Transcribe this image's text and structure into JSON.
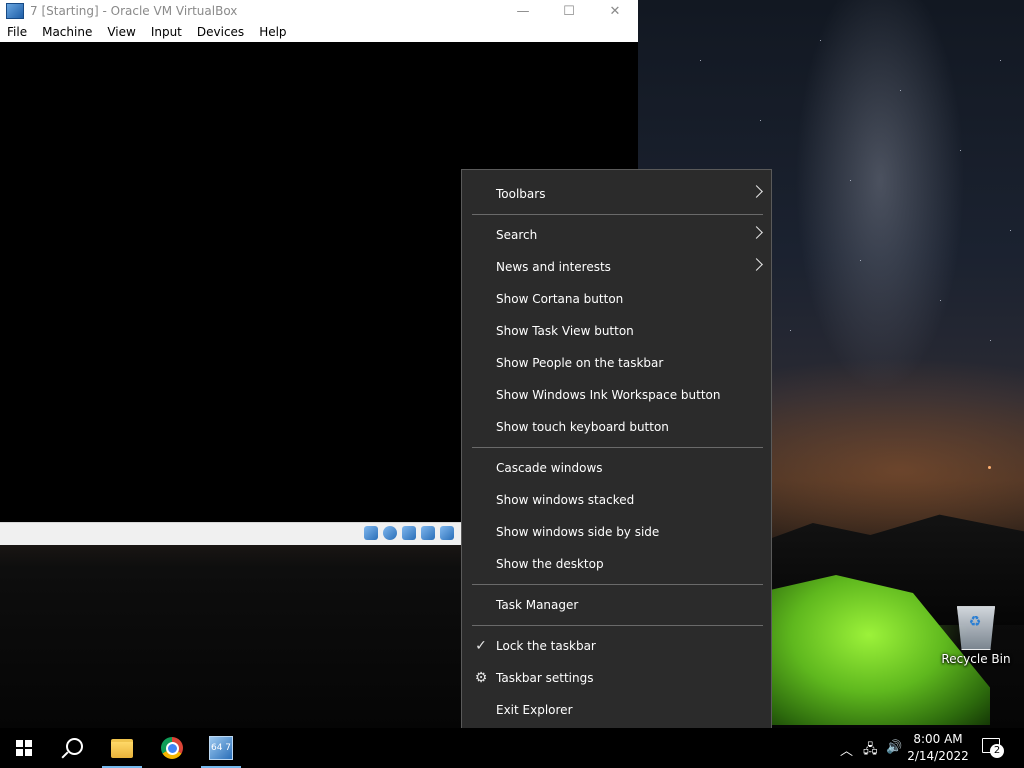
{
  "vbox": {
    "title": "7 [Starting] - Oracle VM VirtualBox",
    "menu": [
      "File",
      "Machine",
      "View",
      "Input",
      "Devices",
      "Help"
    ],
    "window_buttons": {
      "minimize": "—",
      "maximize": "☐",
      "close": "✕"
    }
  },
  "context_menu": {
    "items": [
      {
        "label": "Toolbars",
        "submenu": true
      },
      {
        "label": "Search",
        "submenu": true
      },
      {
        "label": "News and interests",
        "submenu": true
      },
      {
        "label": "Show Cortana button"
      },
      {
        "label": "Show Task View button"
      },
      {
        "label": "Show People on the taskbar"
      },
      {
        "label": "Show Windows Ink Workspace button"
      },
      {
        "label": "Show touch keyboard button"
      },
      {
        "label": "Cascade windows"
      },
      {
        "label": "Show windows stacked"
      },
      {
        "label": "Show windows side by side"
      },
      {
        "label": "Show the desktop"
      },
      {
        "label": "Task Manager"
      },
      {
        "label": "Lock the taskbar",
        "checked": true
      },
      {
        "label": "Taskbar settings",
        "icon": "gear-icon"
      },
      {
        "label": "Exit Explorer"
      }
    ]
  },
  "desktop": {
    "recycle_bin_label": "Recycle Bin"
  },
  "taskbar": {
    "pinned": [
      "start-icon",
      "search-icon",
      "file-explorer-icon",
      "chrome-icon",
      "virtualbox-icon"
    ],
    "vbox_icon_text": "64 7",
    "clock_time": "8:00 AM",
    "clock_date": "2/14/2022",
    "notification_count": "2",
    "accent_color": "#76b9ed"
  }
}
